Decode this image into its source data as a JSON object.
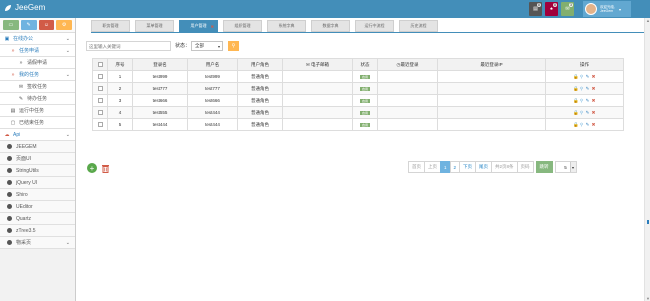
{
  "topbar": {
    "app_name": "JeeGem",
    "icons": [
      {
        "name": "mail-box",
        "badge": "8",
        "color": "#555555"
      },
      {
        "name": "bell",
        "badge": "8",
        "color": "#d15b47"
      },
      {
        "name": "envelope",
        "badge": "3",
        "color": "#82af6f"
      }
    ],
    "user": {
      "welcome": "欢迎光临,",
      "name": "JeeGem"
    }
  },
  "shortcut_colors": [
    "#87b87f",
    "#6fb3e0",
    "#d15b47",
    "#ffb752"
  ],
  "sidebar": {
    "sections": [
      {
        "label": "在线办公",
        "type": "header"
      },
      {
        "label": "任务申请",
        "type": "sub"
      },
      {
        "label": "请假申请",
        "type": "subsub"
      },
      {
        "label": "我的任务",
        "type": "sub"
      },
      {
        "label": "签收任务",
        "type": "subsub"
      },
      {
        "label": "待办任务",
        "type": "subsub"
      },
      {
        "label": "运行中任务",
        "type": "sub"
      },
      {
        "label": "已结束任务",
        "type": "sub"
      },
      {
        "label": "Api",
        "type": "header"
      },
      {
        "label": "JEEGEM",
        "type": "lib"
      },
      {
        "label": "页面UI",
        "type": "lib"
      },
      {
        "label": "StringUtils",
        "type": "lib"
      },
      {
        "label": "jQuery UI",
        "type": "lib"
      },
      {
        "label": "Shiro",
        "type": "lib"
      },
      {
        "label": "UEditor",
        "type": "lib"
      },
      {
        "label": "Quartz",
        "type": "lib"
      },
      {
        "label": "zTree3.5",
        "type": "lib"
      },
      {
        "label": "物采页",
        "type": "lib"
      }
    ]
  },
  "tabs": [
    {
      "label": "职务管理",
      "active": false
    },
    {
      "label": "菜单管理",
      "active": false
    },
    {
      "label": "用户管理",
      "active": true
    },
    {
      "label": "组织管理",
      "active": false
    },
    {
      "label": "系统字典",
      "active": false
    },
    {
      "label": "数据字典",
      "active": false
    },
    {
      "label": "运行中流程",
      "active": false
    },
    {
      "label": "历史流程",
      "active": false
    }
  ],
  "filters": {
    "search_placeholder": "这里输入关键词",
    "status_label": "状态：",
    "status_value": "全部"
  },
  "table": {
    "headers": [
      "",
      "序号",
      "登录名",
      "用户名",
      "用户角色",
      "电子邮箱",
      "状态",
      "最近登录",
      "最近登录IP",
      "操作"
    ],
    "rows": [
      {
        "index": "1",
        "login": "test999",
        "username": "test999",
        "role": "普通角色",
        "email": "",
        "status": "启用",
        "last_login": "",
        "last_ip": ""
      },
      {
        "index": "2",
        "login": "test777",
        "username": "test777",
        "role": "普通角色",
        "email": "",
        "status": "启用",
        "last_login": "",
        "last_ip": ""
      },
      {
        "index": "3",
        "login": "test666",
        "username": "test666",
        "role": "普通角色",
        "email": "",
        "status": "启用",
        "last_login": "",
        "last_ip": ""
      },
      {
        "index": "4",
        "login": "test555",
        "username": "test444",
        "role": "普通角色",
        "email": "",
        "status": "启用",
        "last_login": "",
        "last_ip": ""
      },
      {
        "index": "5",
        "login": "test444",
        "username": "test444",
        "role": "普通角色",
        "email": "",
        "status": "启用",
        "last_login": "",
        "last_ip": ""
      }
    ],
    "op_icons": [
      "lock-icon",
      "search-icon",
      "edit-icon",
      "delete-icon"
    ],
    "op_colors": [
      "#ffb752",
      "#6fb3e0",
      "#2b7dbc",
      "#d15b47"
    ]
  },
  "pagination": {
    "first": "首页",
    "prev": "上页",
    "pages": [
      "1",
      "2"
    ],
    "current": "1",
    "next": "下页",
    "last": "尾页",
    "total": "共2页8条",
    "goto_placeholder": "页码",
    "go": "跳转",
    "page_size": "5"
  }
}
